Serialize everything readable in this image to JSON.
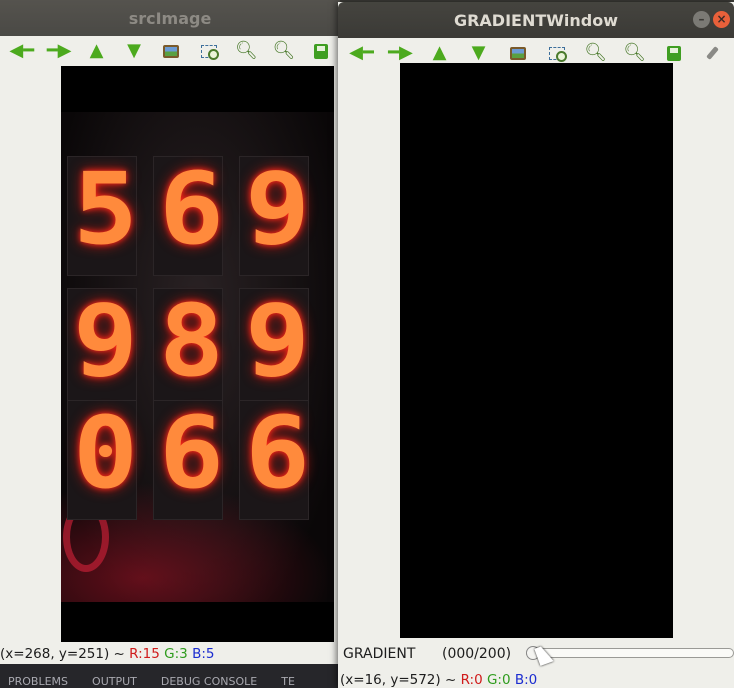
{
  "src_window": {
    "title": "srcImage",
    "toolbar": [
      "arrow-left-icon",
      "arrow-right-icon",
      "arrow-up-icon",
      "arrow-down-icon",
      "image-icon",
      "zoom-rect-icon",
      "zoom-in-icon",
      "zoom-out-icon",
      "save-icon"
    ],
    "display": {
      "rows": [
        [
          "5",
          "6",
          "9"
        ],
        [
          "9",
          "8",
          "9"
        ],
        [
          "0",
          "6",
          "6"
        ]
      ]
    },
    "status": {
      "coords": "(x=268, y=251) ~ ",
      "r": "R:15",
      "g": "G:3",
      "b": "B:5"
    }
  },
  "gradient_window": {
    "title": "GRADIENTWindow",
    "toolbar": [
      "arrow-left-icon",
      "arrow-right-icon",
      "arrow-up-icon",
      "arrow-down-icon",
      "image-icon",
      "zoom-rect-icon",
      "zoom-in-icon",
      "zoom-out-icon",
      "save-icon",
      "brush-icon"
    ],
    "trackbar": {
      "label": "GRADIENT",
      "value_text": "(000/200)",
      "value": 0,
      "max": 200
    },
    "status": {
      "coords": "(x=16, y=572) ~ ",
      "r": "R:0",
      "g": "G:0",
      "b": "B:0"
    }
  },
  "bottom_tabs": [
    "PROBLEMS",
    "OUTPUT",
    "DEBUG CONSOLE",
    "TE"
  ]
}
